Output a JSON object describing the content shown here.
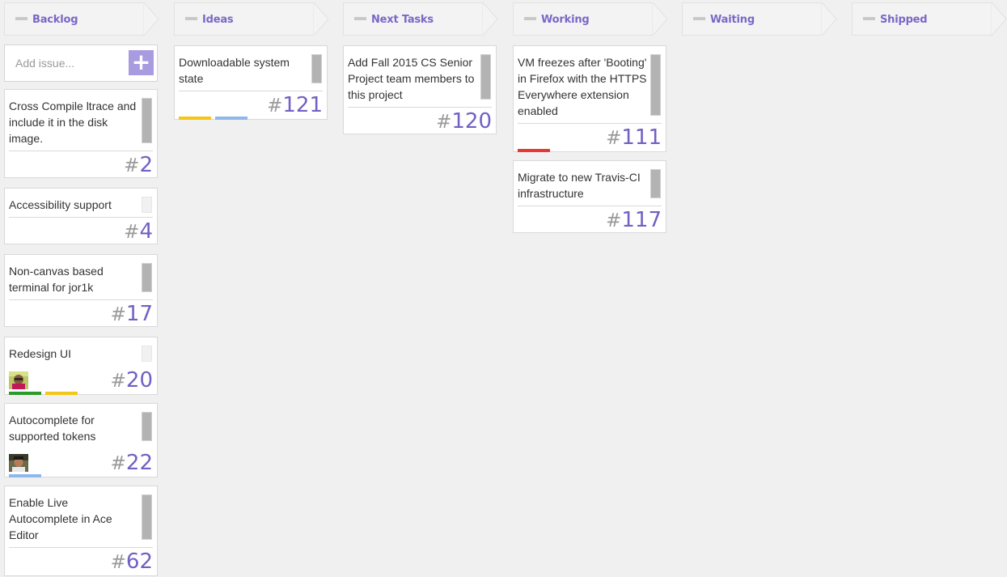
{
  "search": {
    "placeholder": "Add issue..."
  },
  "colors": {
    "accent": "#7260c4",
    "add_button": "#a99be0",
    "label_yellow": "#f5c518",
    "label_blue": "#8fb7ea",
    "label_green": "#2a9a2a",
    "label_red": "#e53935"
  },
  "columns": [
    {
      "name": "Backlog"
    },
    {
      "name": "Ideas"
    },
    {
      "name": "Next Tasks"
    },
    {
      "name": "Working"
    },
    {
      "name": "Waiting"
    },
    {
      "name": "Shipped"
    }
  ],
  "cards": {
    "c2": {
      "title": "Cross Compile ltrace and include it in the disk image.",
      "number": "2",
      "hash": "#"
    },
    "c4": {
      "title": "Accessibility support",
      "number": "4",
      "hash": "#"
    },
    "c17": {
      "title": "Non-canvas based terminal for jor1k",
      "number": "17",
      "hash": "#"
    },
    "c20": {
      "title": "Redesign UI",
      "number": "20",
      "hash": "#",
      "labels": [
        "green",
        "yellow"
      ]
    },
    "c22": {
      "title": "Autocomplete for supported tokens",
      "number": "22",
      "hash": "#",
      "labels": [
        "blue"
      ]
    },
    "c62": {
      "title": "Enable Live Autocomplete in Ace Editor",
      "number": "62",
      "hash": "#"
    },
    "c121": {
      "title": "Downloadable system state",
      "number": "121",
      "hash": "#",
      "labels": [
        "yellow",
        "blue"
      ]
    },
    "c120": {
      "title": "Add Fall 2015 CS Senior Project team members to this project",
      "number": "120",
      "hash": "#"
    },
    "c111": {
      "title": "VM freezes after 'Booting' in Firefox with the HTTPS Everywhere extension enabled",
      "number": "111",
      "hash": "#",
      "labels": [
        "red"
      ]
    },
    "c117": {
      "title": "Migrate to new Travis-CI infrastructure",
      "number": "117",
      "hash": "#"
    }
  }
}
